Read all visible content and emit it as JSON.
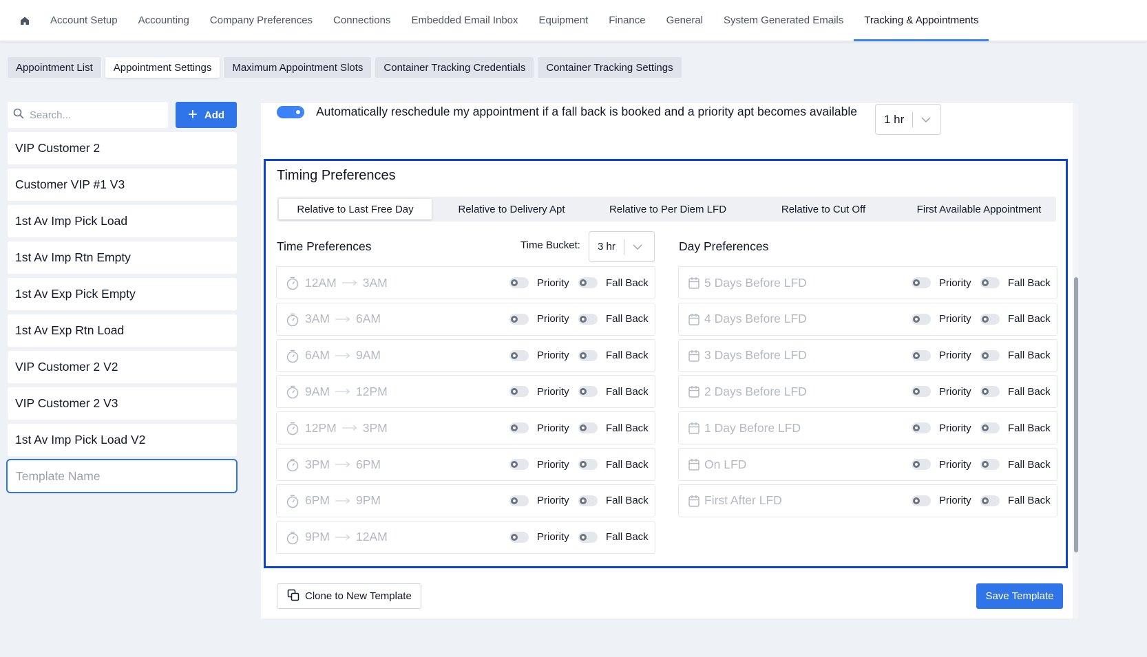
{
  "nav": {
    "items": [
      "Account Setup",
      "Accounting",
      "Company Preferences",
      "Connections",
      "Embedded Email Inbox",
      "Equipment",
      "Finance",
      "General",
      "System Generated Emails",
      "Tracking & Appointments"
    ],
    "active_index": 9
  },
  "subtabs": {
    "items": [
      "Appointment List",
      "Appointment Settings",
      "Maximum Appointment Slots",
      "Container Tracking Credentials",
      "Container Tracking Settings"
    ],
    "active_index": 1
  },
  "sidebar": {
    "search_placeholder": "Search...",
    "add_label": "Add",
    "templates": [
      "VIP Customer 2",
      "Customer VIP #1 V3",
      "1st Av Imp Pick Load",
      "1st Av Imp Rtn Empty",
      "1st Av Exp Pick Empty",
      "1st Av Exp Rtn Load",
      "VIP Customer 2 V2",
      "VIP Customer 2 V3",
      "1st Av Imp Pick Load V2"
    ],
    "template_name_placeholder": "Template Name"
  },
  "auto": {
    "text": "Automatically reschedule my appointment if a fall back is booked and a priority apt becomes available",
    "enabled": true,
    "value": "1 hr"
  },
  "timing": {
    "title": "Timing Preferences",
    "modes": [
      "Relative to Last Free Day",
      "Relative to Delivery Apt",
      "Relative to Per Diem LFD",
      "Relative to Cut Off",
      "First Available Appointment"
    ],
    "active_mode_index": 0,
    "time_title": "Time Preferences",
    "bucket_label": "Time Bucket:",
    "bucket_value": "3 hr",
    "day_title": "Day Preferences",
    "priority_label": "Priority",
    "fallback_label": "Fall Back",
    "time_rows": [
      {
        "from": "12AM",
        "to": "3AM"
      },
      {
        "from": "3AM",
        "to": "6AM"
      },
      {
        "from": "6AM",
        "to": "9AM"
      },
      {
        "from": "9AM",
        "to": "12PM"
      },
      {
        "from": "12PM",
        "to": "3PM"
      },
      {
        "from": "3PM",
        "to": "6PM"
      },
      {
        "from": "6PM",
        "to": "9PM"
      },
      {
        "from": "9PM",
        "to": "12AM"
      }
    ],
    "day_rows": [
      "5 Days Before LFD",
      "4 Days Before LFD",
      "3 Days Before LFD",
      "2 Days Before LFD",
      "1 Day Before LFD",
      "On LFD",
      "First After LFD"
    ]
  },
  "actions": {
    "clone_label": "Clone to New Template",
    "save_label": "Save Template"
  },
  "colors": {
    "primary": "#2f74e8",
    "highlight_border": "#0a45d8",
    "muted_text": "#b3b9c3"
  }
}
